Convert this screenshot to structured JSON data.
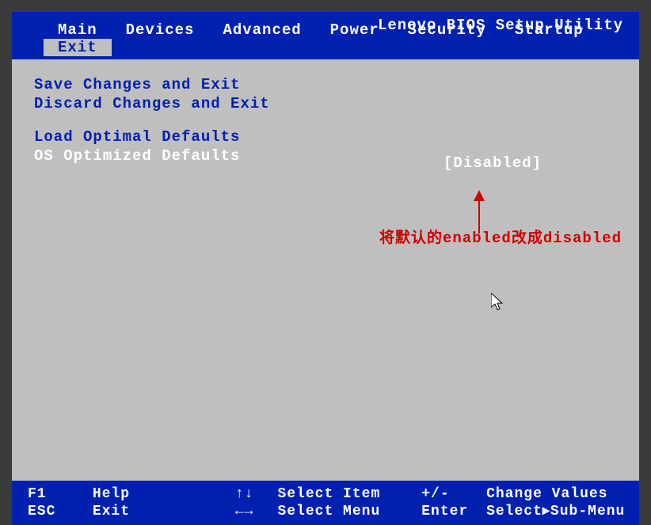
{
  "title": "Lenovo BIOS Setup Utility",
  "tabs": {
    "main": "Main",
    "devices": "Devices",
    "advanced": "Advanced",
    "power": "Power",
    "security": "Security",
    "startup": "Startup",
    "exit": "Exit"
  },
  "menu": {
    "save_exit": "Save Changes and Exit",
    "discard_exit": "Discard Changes and Exit",
    "load_defaults": "Load Optimal Defaults",
    "os_defaults": "OS Optimized Defaults"
  },
  "value": {
    "os_defaults": "[Disabled]"
  },
  "annotation": "将默认的enabled改成disabled",
  "footer": {
    "f1_key": "F1",
    "f1_label": "Help",
    "updown_key": "↑↓",
    "updown_label": "Select Item",
    "plusminus_key": "+/-",
    "plusminus_label": "Change Values",
    "esc_key": "ESC",
    "esc_label": "Exit",
    "leftright_key": "←→",
    "leftright_label": "Select Menu",
    "enter_key": "Enter",
    "enter_label": "Select▸Sub-Menu"
  }
}
